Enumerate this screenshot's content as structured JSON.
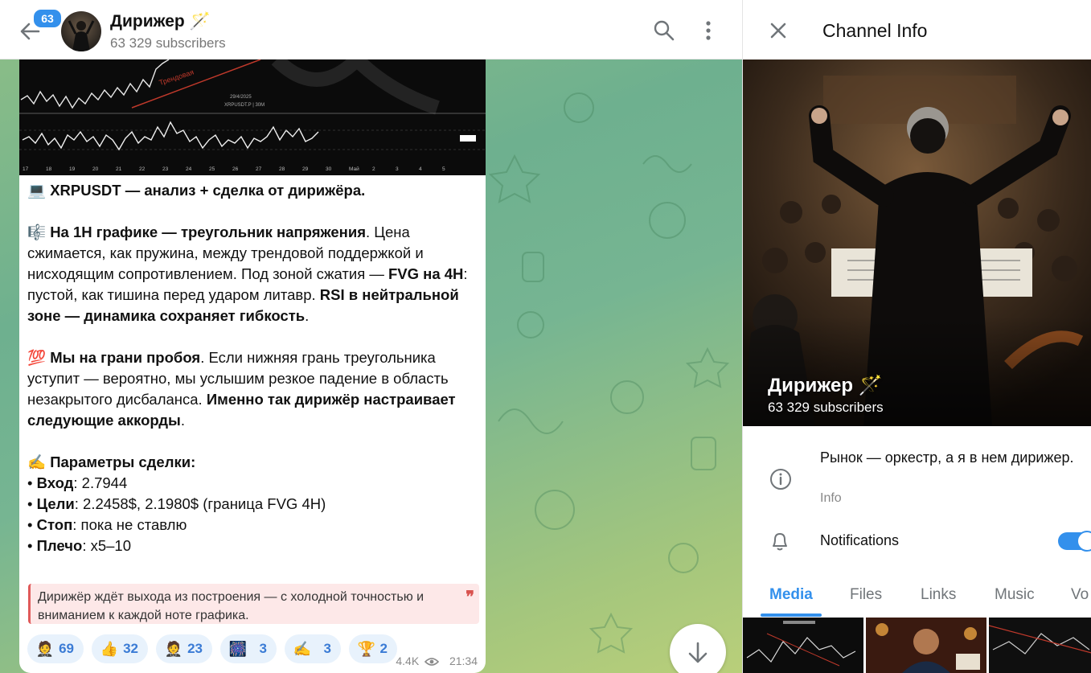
{
  "header": {
    "unread_badge": "63",
    "channel_title": "Дирижер 🪄",
    "subscribers": "63 329 subscribers"
  },
  "message": {
    "paragraphs": [
      [
        {
          "t": "💻 "
        },
        {
          "t": "XRPUSDT — анализ + сделка от дирижёра.",
          "b": true
        }
      ],
      [
        {
          "t": "🎼 "
        },
        {
          "t": "На 1H графике — треугольник напряжения",
          "b": true
        },
        {
          "t": ". Цена сжимается, как пружина, между трендовой поддержкой и нисходящим сопротивлением. Под зоной сжатия — "
        },
        {
          "t": "FVG на 4H",
          "b": true
        },
        {
          "t": ": пустой, как тишина перед ударом литавр. "
        },
        {
          "t": "RSI в нейтральной зоне — динамика сохраняет гибкость",
          "b": true
        },
        {
          "t": "."
        }
      ],
      [
        {
          "t": "💯 "
        },
        {
          "t": "Мы на грани пробоя",
          "b": true
        },
        {
          "t": ". Если нижняя грань треугольника уступит — вероятно, мы услышим резкое падение в область незакрытого дисбаланса. "
        },
        {
          "t": "Именно так дирижёр настраивает следующие аккорды",
          "b": true
        },
        {
          "t": "."
        }
      ],
      [
        {
          "t": "✍️ "
        },
        {
          "t": "Параметры сделки:",
          "b": true
        }
      ]
    ],
    "params": [
      {
        "label": "Вход",
        "value": ": 2.7944"
      },
      {
        "label": "Цели",
        "value": ": 2.2458$, 2.1980$ (граница FVG 4H)"
      },
      {
        "label": "Стоп",
        "value": ": пока не ставлю"
      },
      {
        "label": "Плечо",
        "value": ": x5–10"
      }
    ],
    "quote": "Дирижёр ждёт выхода из построения — с холодной точностью и вниманием к каждой ноте графика.",
    "reactions": [
      {
        "emoji": "🤵",
        "count": "69"
      },
      {
        "emoji": "👍",
        "count": "32"
      },
      {
        "emoji": "🤵",
        "count": "23"
      },
      {
        "emoji": "🎆",
        "count": "3"
      },
      {
        "emoji": "✍️",
        "count": "3"
      },
      {
        "emoji": "🏆",
        "count": "2"
      }
    ],
    "views": "4.4K",
    "time": "21:34",
    "chart_caption_date": "29/4/2025",
    "chart_caption_pair": "XRPUSDT.P | 30M",
    "chart_trend_label": "Трендовая",
    "chart_x_ticks": [
      "17",
      "18",
      "19",
      "20",
      "21",
      "22",
      "23",
      "24",
      "25",
      "26",
      "27",
      "28",
      "29",
      "30",
      "Май",
      "2",
      "3",
      "4",
      "5"
    ]
  },
  "panel": {
    "title": "Channel Info",
    "cover_name": "Дирижер 🪄",
    "cover_subs": "63 329 subscribers",
    "description": "Рынок — оркестр, а я в нем дирижер.",
    "description_label": "Info",
    "notifications_label": "Notifications",
    "notifications_on": true,
    "tabs": [
      "Media",
      "Files",
      "Links",
      "Music",
      "Vo"
    ],
    "active_tab": "Media"
  },
  "colors": {
    "accent": "#3390ec",
    "quote_border": "#e05a5a",
    "quote_bg": "#fde8e8"
  }
}
